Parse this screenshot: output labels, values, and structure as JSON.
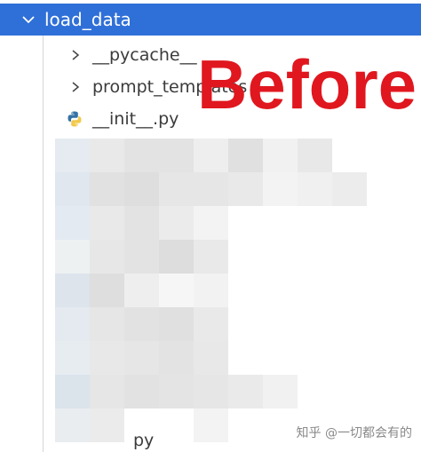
{
  "explorer": {
    "root_folder": {
      "label": "load_data",
      "expanded": true
    },
    "items": [
      {
        "type": "folder",
        "label": "__pycache__",
        "expanded": false
      },
      {
        "type": "folder",
        "label": "prompt_templates",
        "expanded": false
      },
      {
        "type": "file",
        "label": "__init__.py",
        "icon": "python-file-icon"
      }
    ],
    "partial_tail_text": "py"
  },
  "overlay": {
    "text": "Before",
    "color": "#e0171f"
  },
  "watermark": "知乎 @一切都会有的",
  "colors": {
    "selection_bg": "#2f6fd8",
    "text": "#3b3b3b",
    "guide": "#d6d6d6",
    "python_blue": "#3572a5",
    "python_yellow": "#f2c94c"
  },
  "mosaic": {
    "rows": [
      [
        "#e6ebf1",
        "#e9e9e9",
        "#e3e3e3",
        "#e3e3e3",
        "#eeeeee",
        "#e0e0e0",
        "#f1f1f1",
        "#e8e8e8"
      ],
      [
        "#e0e7ef",
        "#e1e1e1",
        "#dedede",
        "#e6e6e6",
        "#e6e6e6",
        "#e9e9e9",
        "#f3f3f3",
        "#f0f0f0",
        "#ececec"
      ],
      [
        "#e4eaf2",
        "#e9e9e9",
        "#e3e3e3",
        "#ebebeb",
        "#f3f3f3",
        "#ffffff",
        "#ffffff",
        "#ffffff"
      ],
      [
        "#eef1f2",
        "#e7e7e7",
        "#e3e3e3",
        "#dddddd",
        "#e9e9e9",
        "#ffffff"
      ],
      [
        "#dde4ec",
        "#dedede",
        "#eeeeee",
        "#f6f6f6",
        "#f2f2f2",
        "#ffffff"
      ],
      [
        "#e5eaf0",
        "#e6e6e6",
        "#e2e2e2",
        "#e0e0e0",
        "#e9e9e9",
        "#ffffff"
      ],
      [
        "#e7ecf1",
        "#e8e8e8",
        "#e6e6e6",
        "#e3e3e3",
        "#e8e8e8",
        "#ffffff"
      ],
      [
        "#dbe3eb",
        "#e6e6e6",
        "#e2e2e2",
        "#e4e4e4",
        "#e6e6e6",
        "#eaeaea",
        "#f1f1f1",
        "#ffffff"
      ],
      [
        "#eaedf0",
        "#ebebeb",
        "#ffffff",
        "#ffffff",
        "#f3f3f3",
        "#ffffff"
      ]
    ]
  }
}
